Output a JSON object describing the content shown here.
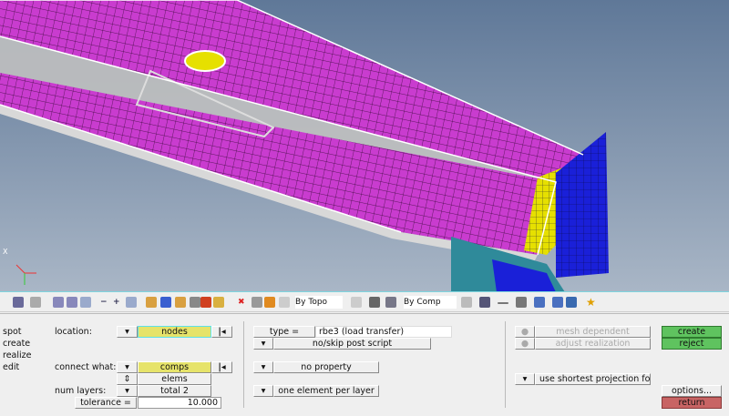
{
  "viewport": {
    "axis_label": "X",
    "colors": {
      "mesh": "#cc33cc",
      "accent": "#e6e000",
      "background_top": "#5f7898",
      "background_bottom": "#a9b6c6"
    }
  },
  "toolbar": {
    "topo_select": "By Topo",
    "comp_select": "By Comp"
  },
  "menu": [
    "spot",
    "create",
    "realize",
    "edit"
  ],
  "form": {
    "location_label": "location:",
    "location_value": "nodes",
    "connect_label": "connect what:",
    "connect_value": "comps",
    "connect_type": "elems",
    "layers_label": "num layers:",
    "layers_value": "total 2",
    "tolerance_label": "tolerance =",
    "tolerance_value": "10.000",
    "type_label": "type =",
    "type_value": "rbe3 (load transfer)",
    "post_script": "no/skip post script",
    "property": "no property",
    "layer_option": "one element per layer",
    "mesh_dependent": "mesh dependent",
    "adjust_realization": "adjust realization",
    "projection": "use shortest projection for ce"
  },
  "actions": {
    "create": "create",
    "reject": "reject",
    "options": "options...",
    "return": "return"
  }
}
